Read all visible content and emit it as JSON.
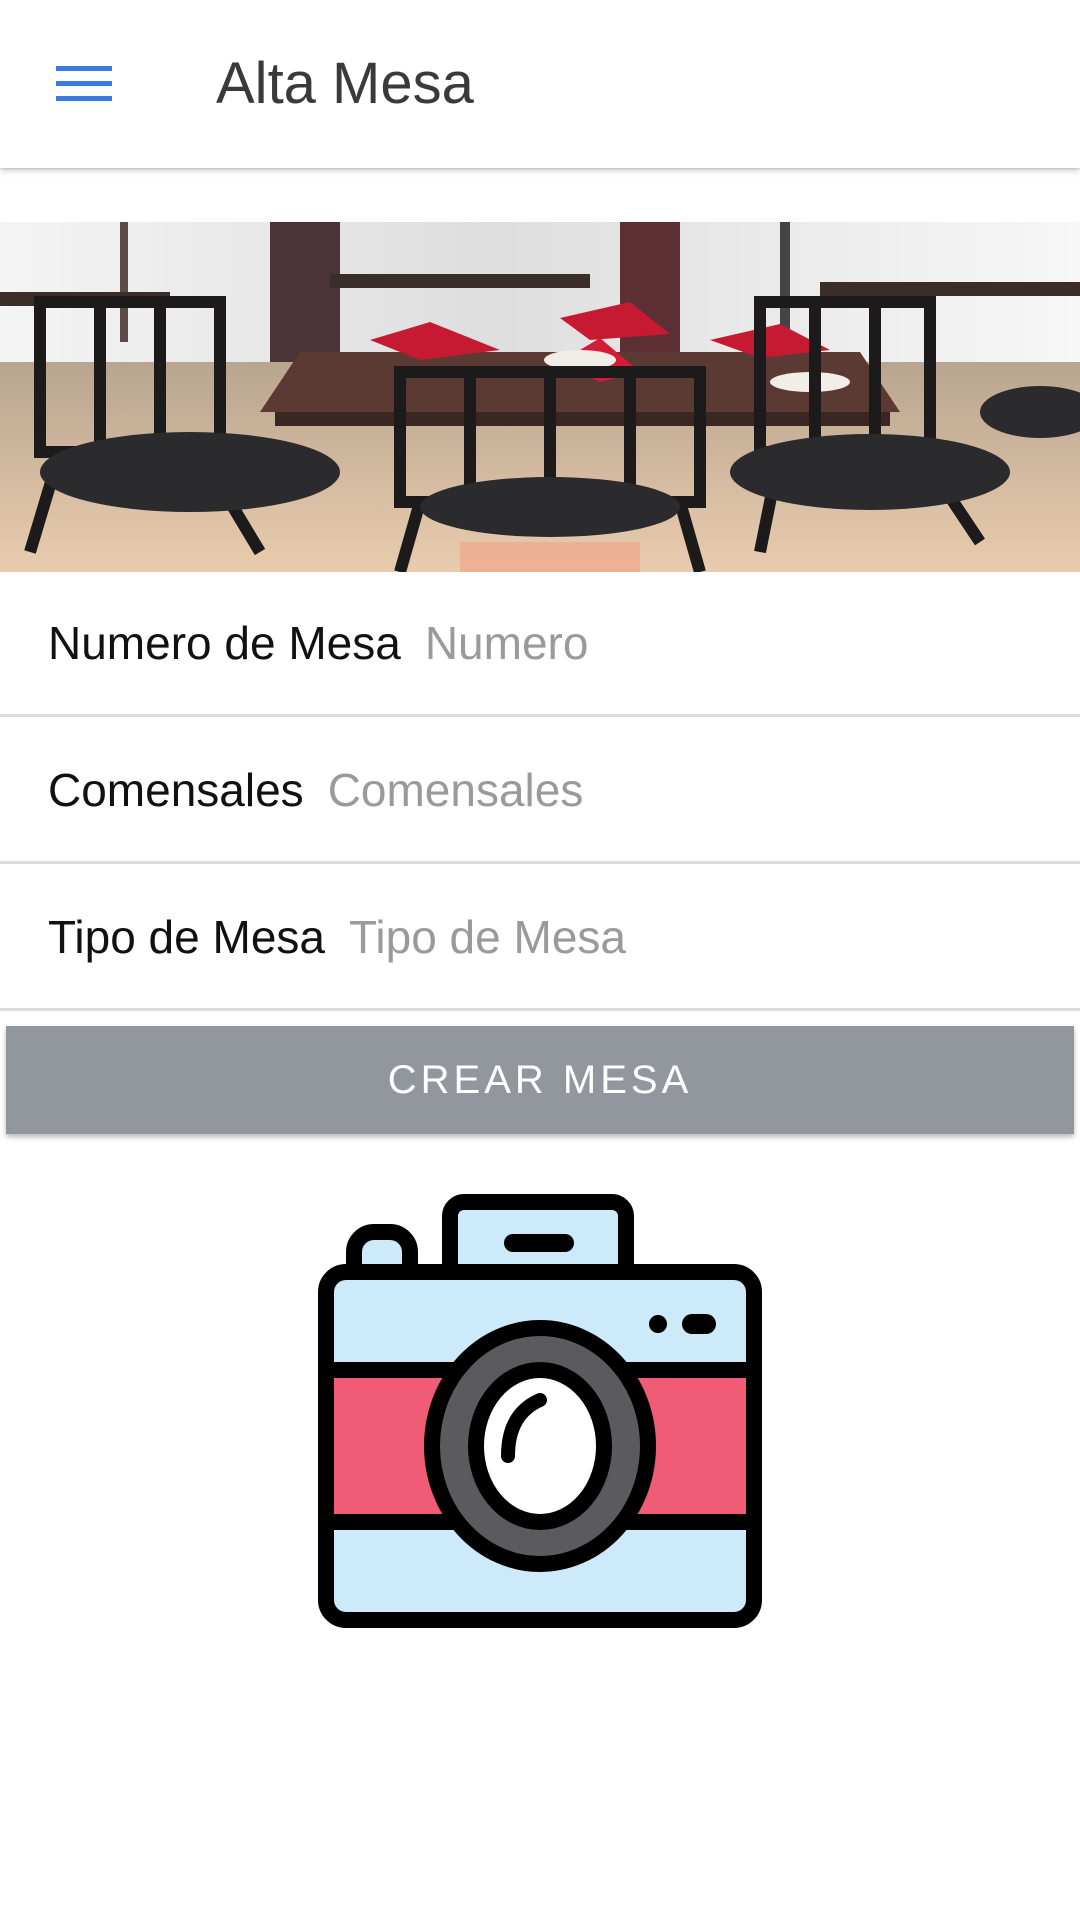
{
  "toolbar": {
    "title": "Alta Mesa",
    "menu_icon": "hamburger-menu-icon",
    "accent_color": "#3b7be0"
  },
  "hero": {
    "image": "restaurant-tables-photo"
  },
  "form": {
    "fields": [
      {
        "label": "Numero de Mesa",
        "placeholder": "Numero",
        "value": ""
      },
      {
        "label": "Comensales",
        "placeholder": "Comensales",
        "value": ""
      },
      {
        "label": "Tipo de Mesa",
        "placeholder": "Tipo de Mesa",
        "value": ""
      }
    ]
  },
  "actions": {
    "create_label": "CREAR MESA",
    "button_color": "#92969d"
  },
  "camera": {
    "icon": "camera-icon",
    "colors": {
      "body_top": "#cdeafb",
      "band": "#f05b75",
      "lens": "#5b5b5f",
      "outline": "#000000"
    }
  }
}
